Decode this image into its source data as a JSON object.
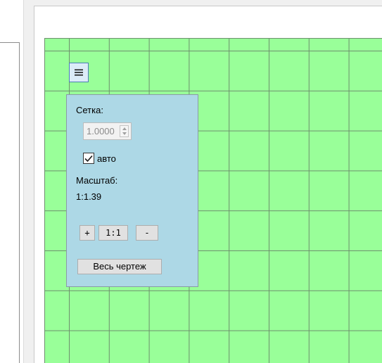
{
  "grid_panel": {
    "menu_icon": "hamburger-icon",
    "grid_label": "Сетка:",
    "grid_value": "1.0000",
    "auto_checked": true,
    "auto_label": "авто",
    "scale_label": "Масштаб:",
    "scale_value": "1:1.39",
    "zoom_in_label": "+",
    "zoom_reset_label": "1:1",
    "zoom_out_label": "-",
    "whole_drawing_label": "Весь чертеж"
  },
  "colors": {
    "canvas_background": "#99ff99",
    "grid_lines": "#6e8f6e",
    "panel_background": "#add8e6"
  }
}
